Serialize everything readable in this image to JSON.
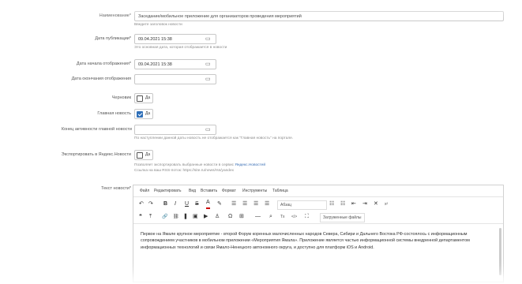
{
  "fields": {
    "title": {
      "label": "Наименование*",
      "value": "Заседание/мобильное приложение для организаторов проведения мероприятий",
      "hint": "Введите заголовок новости"
    },
    "pub_date": {
      "label": "Дата публикации*",
      "value": "09.04.2021 15:38",
      "hint": "Это основная дата, которая отображается в новости"
    },
    "display_start": {
      "label": "Дата начала отображения*",
      "value": "09.04.2021 15:38"
    },
    "display_end": {
      "label": "Дата окончания отображения",
      "value": ""
    },
    "draft": {
      "label": "Черновик",
      "check_label": "Да",
      "checked": false
    },
    "main_news": {
      "label": "Главная новость",
      "check_label": "Да",
      "checked": true
    },
    "main_news_end": {
      "label": "Конец активности главной новости",
      "value": "",
      "hint": "По наступлении данной даты новость не отображается как \"Главная новость\" на портале."
    },
    "yandex_export": {
      "label": "Экспортировать в Яндекс.Новости",
      "check_label": "Да",
      "checked": false,
      "hint1_prefix": "Позволяет экспортировать выбранные новости в сервис ",
      "hint1_link": "Яндекс.Новостей",
      "hint2": "Ссылка на ваш RSS-поток: https://site.ru/news/rss/yandex"
    },
    "text": {
      "label": "Текст новости*"
    }
  },
  "editor": {
    "menu": [
      "Файл",
      "Редактировать",
      "Вид",
      "Вставить",
      "Формат",
      "Инструменты",
      "Таблица"
    ],
    "toolbar_row1": {
      "undo": "↶",
      "redo": "↷",
      "bold": "B",
      "italic": "I",
      "underline": "U",
      "strike": "S",
      "font_color": "A",
      "highlight": "✎",
      "align_left": "☰",
      "align_center": "☰",
      "align_right": "☰",
      "align_justify": "☰",
      "format_select": "Абзац",
      "ul": "☷",
      "ol": "☷",
      "outdent": "⇤",
      "indent": "⇥",
      "clear": "✕",
      "sup": "x²"
    },
    "toolbar_row2": {
      "quote": "❝",
      "upload": "⤒",
      "link": "🔗",
      "unlink": "⛓",
      "bookmark": "❚",
      "image": "▣",
      "media": "▶",
      "person": "♙",
      "omega": "Ω",
      "table": "⊞",
      "hr": "—",
      "search": "⌕",
      "clear_format": "Tx",
      "code": "</>",
      "fullscreen": "⛶",
      "uploaded_files": "Загруженные файлы"
    },
    "content": "Первое на Ямале крупное мероприятие - второй Форум коренных малочисленных народов Севера, Сибири и Дальнего Востока РФ-состоялось с информационным сопровождением участников в мобильном приложении «Мероприятия Ямала». Приложение является частью информационной системы внедренной департаментом информационных технологий и связи Ямало-Ненецкого автономного округа, и доступно для платформ iOS и Android."
  },
  "icons": {
    "calendar": "calendar-icon"
  }
}
